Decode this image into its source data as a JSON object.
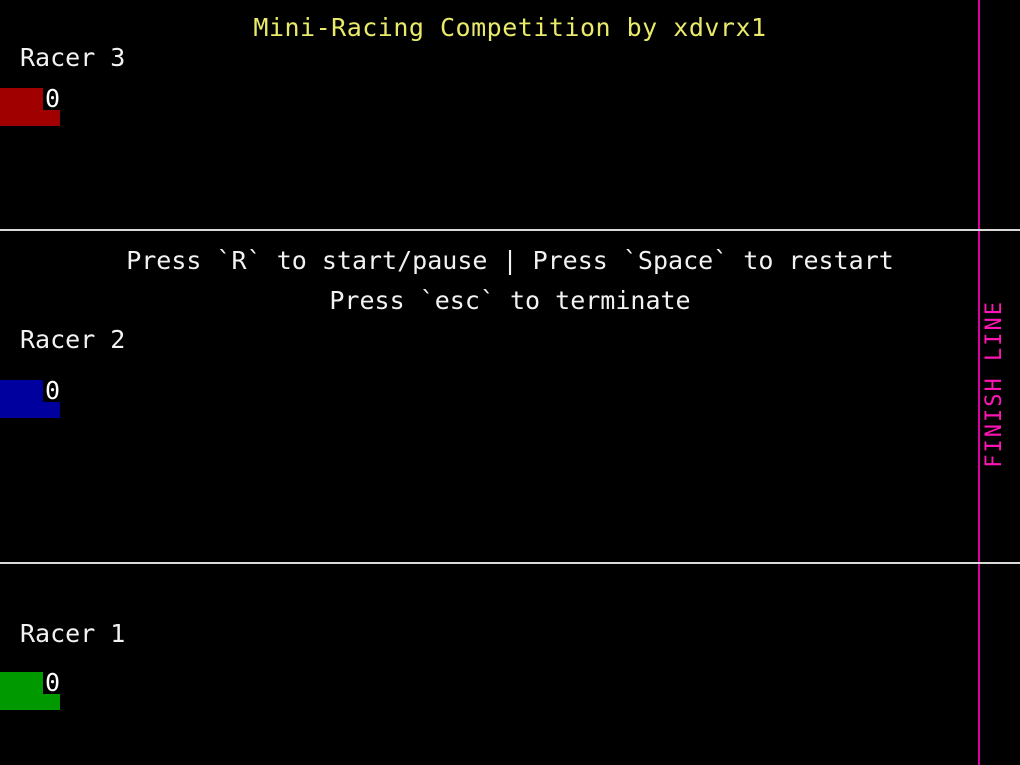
{
  "app": {
    "title": "Mini-Racing Competition by xdvrx1",
    "background_color": "#000000",
    "title_color": "#e9e96a"
  },
  "instructions": {
    "line_1": "Press `R` to start/pause | Press `Space` to restart",
    "line_2": "Press `esc` to terminate",
    "color": "#f2f2f2"
  },
  "finish": {
    "label": "FINISH LINE",
    "line_color": "#d700a0",
    "label_color": "#ff14b4"
  },
  "separator": {
    "color": "#d9d9d9"
  },
  "lanes": [
    {
      "id": "racer3",
      "label": "Racer 3",
      "score": "0",
      "car_color": "#a00000",
      "label_color": "#f2f2f2",
      "score_color": "#ffffff"
    },
    {
      "id": "racer2",
      "label": "Racer 2",
      "score": "0",
      "car_color": "#00009e",
      "label_color": "#f2f2f2",
      "score_color": "#ffffff"
    },
    {
      "id": "racer1",
      "label": "Racer 1",
      "score": "0",
      "car_color": "#009900",
      "label_color": "#f2f2f2",
      "score_color": "#ffffff"
    }
  ]
}
